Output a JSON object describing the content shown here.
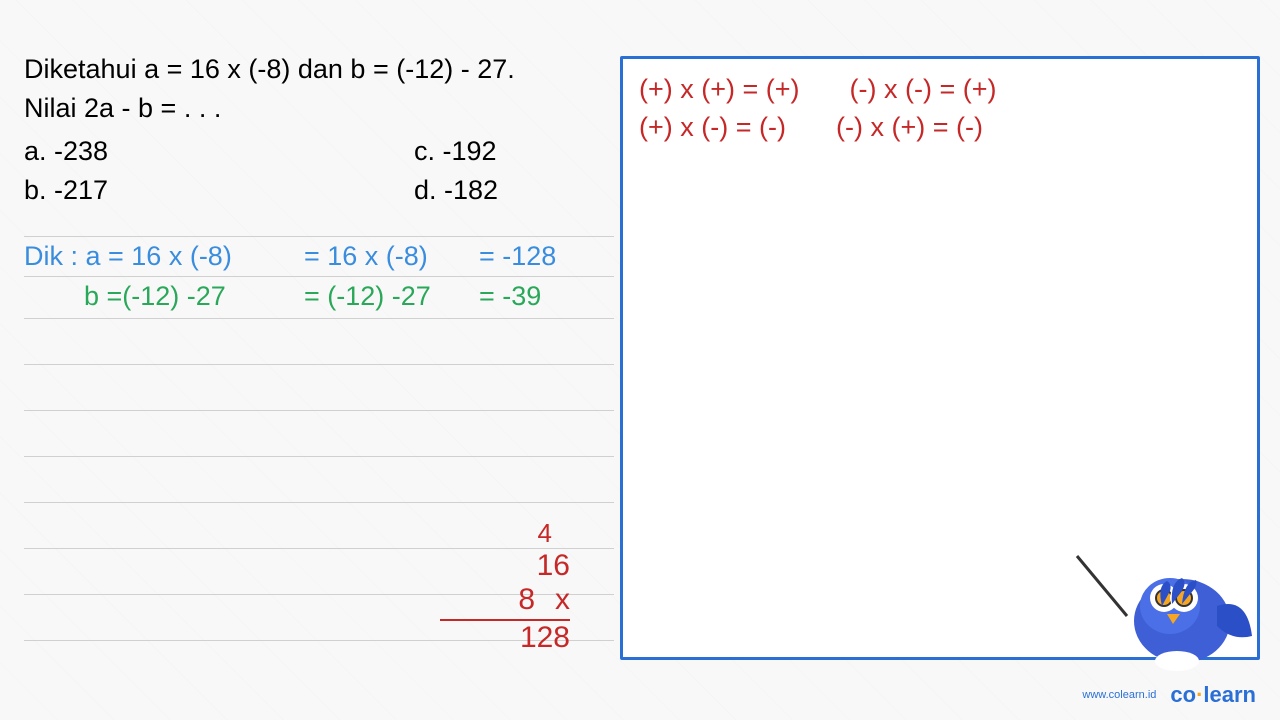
{
  "problem": {
    "line1": "Diketahui a = 16 x (-8) dan b = (-12) - 27.",
    "line2": "Nilai 2a - b =  . . .",
    "options": {
      "a": "a. -238",
      "b": "b. -217",
      "c": "c. -192",
      "d": "d. -182"
    }
  },
  "work": {
    "a_label": "Dik : a = 16 x (-8)",
    "a_mid": "= 16 x (-8)",
    "a_res": "= -128",
    "b_label": "b =(-12) -27",
    "b_mid": "= (-12) -27",
    "b_res": "= -39"
  },
  "calc": {
    "carry": "4",
    "n1": "16",
    "n2": "8",
    "op": "x",
    "result": "128"
  },
  "rules": {
    "r1": "(+) x (+) = (+)",
    "r2": "(-)  x (-)  = (+)",
    "r3": "(+) x (-)  = (-)",
    "r4": "(-)  x (+) = (-)"
  },
  "brand": {
    "url": "www.colearn.id",
    "name_a": "co",
    "name_b": "learn"
  }
}
